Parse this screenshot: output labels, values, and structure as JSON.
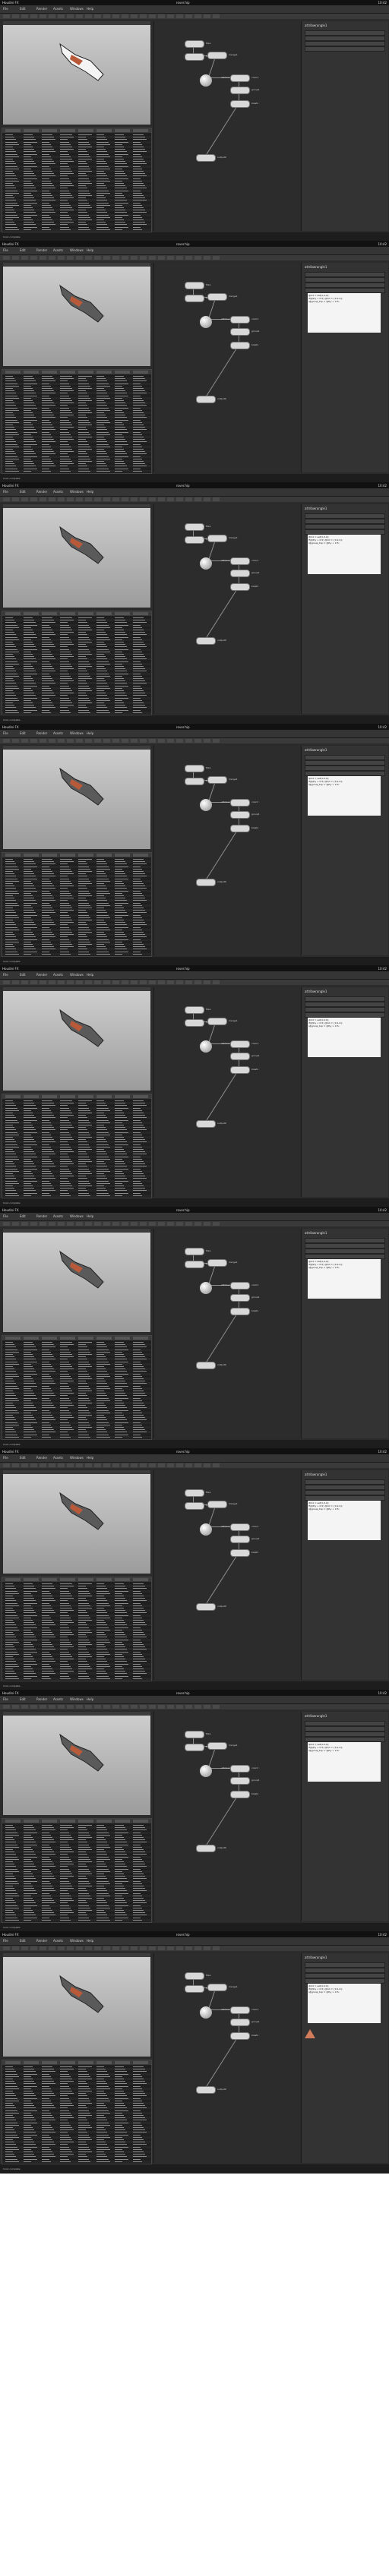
{
  "app": {
    "title": "Houdini FX",
    "file": "rover.hip",
    "clock": "10:42"
  },
  "menus": [
    "File",
    "Edit",
    "Render",
    "Assets",
    "Windows",
    "Help"
  ],
  "network": {
    "path": "/obj/rover",
    "nodes": [
      {
        "name": "file1",
        "type": "pill"
      },
      {
        "name": "transform1",
        "type": "pill"
      },
      {
        "name": "merge1",
        "type": "pill"
      },
      {
        "name": "attribwrangle1",
        "type": "sphere"
      },
      {
        "name": "color1",
        "type": "pill"
      },
      {
        "name": "group1",
        "type": "pill"
      },
      {
        "name": "blast1",
        "type": "pill"
      },
      {
        "name": "output0",
        "type": "pill"
      }
    ]
  },
  "params": {
    "node_label": "attribwrangle1",
    "code_lines": [
      "@Cd = set(1,0,0);",
      "if(@P.y > 0.5) @Cd = {0,1,0};",
      "i@group_top = @P.y > 0.5;"
    ]
  },
  "status": "Cook complete",
  "frames": 9
}
